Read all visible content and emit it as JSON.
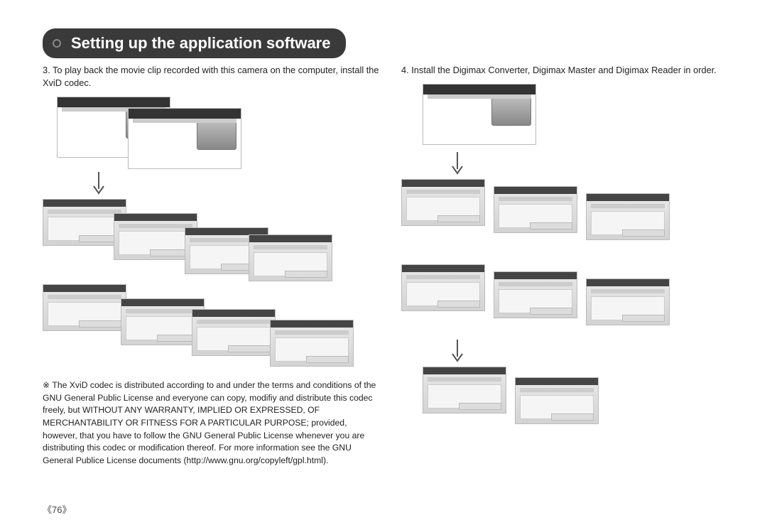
{
  "title": "Setting up the application software",
  "left": {
    "step_num": "3.",
    "step_text": "To play back the movie clip recorded with this camera on the computer, install the XviD codec.",
    "note_marker": "※",
    "note_text": "The XviD codec is distributed according to and under the terms and conditions of the GNU General Public License and everyone can copy, modifiy and distribute this codec freely, but WITHOUT ANY WARRANTY, IMPLIED OR EXPRESSED, OF MERCHANTABILITY OR FITNESS FOR A PARTICULAR PURPOSE; provided, however, that you have to follow the GNU General Public License whenever you are distributing this codec or modification thereof. For more information see the GNU General Publice License documents (http://www.gnu.org/copyleft/gpl.html)."
  },
  "right": {
    "step_num": "4.",
    "step_text": "Install the Digimax Converter, Digimax Master and Digimax Reader in order."
  },
  "page_number": "《76》"
}
